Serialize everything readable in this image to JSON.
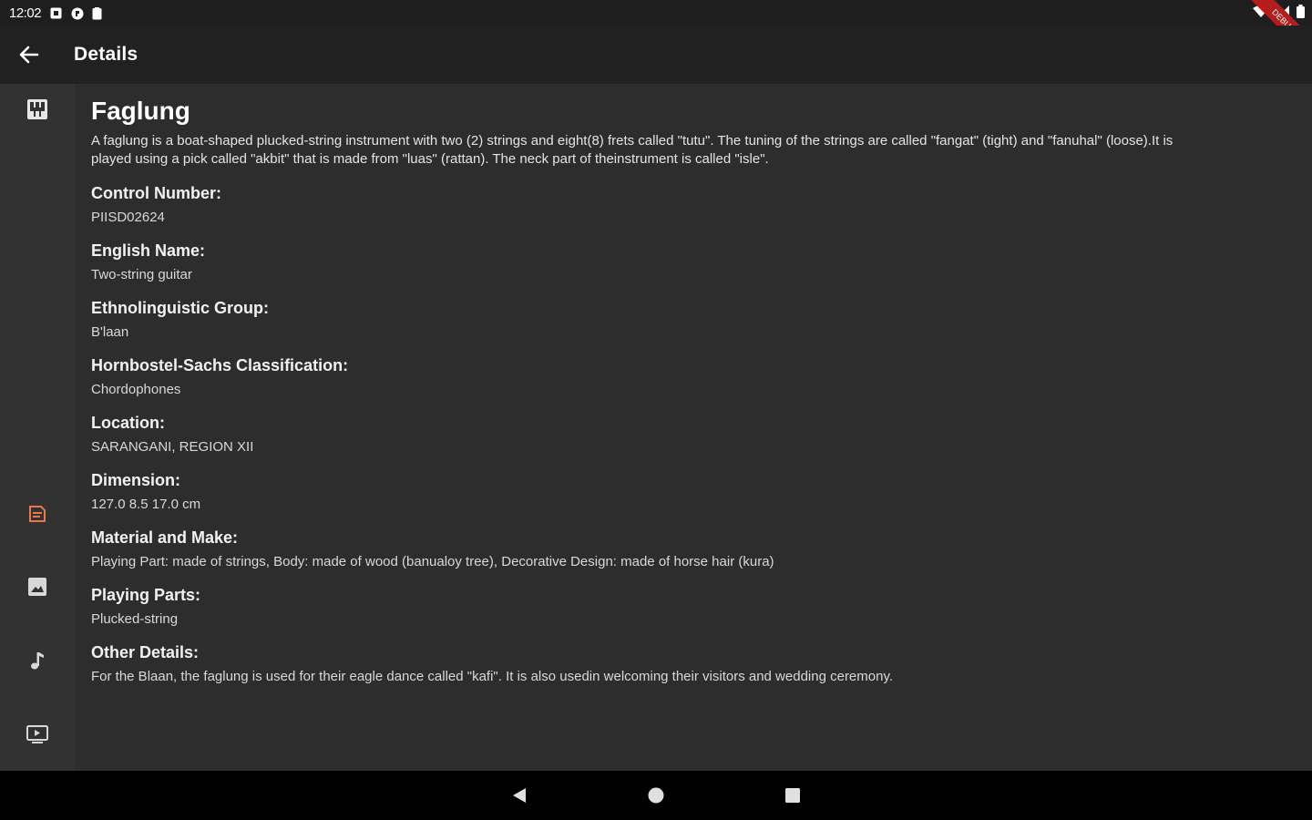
{
  "status_bar": {
    "time": "12:02",
    "icons_left": [
      "notification-icon",
      "system-icon",
      "battery-saver-icon"
    ],
    "icons_right": [
      "wifi-icon",
      "signal-icon",
      "battery-icon"
    ]
  },
  "debug_banner": "DEBUG",
  "app_bar": {
    "title": "Details",
    "back_icon": "arrow-back-icon"
  },
  "rail": {
    "items": [
      {
        "icon": "piano-icon",
        "active": false
      },
      {
        "icon": "article-icon",
        "active": true
      },
      {
        "icon": "image-icon",
        "active": false
      },
      {
        "icon": "music-note-icon",
        "active": false
      },
      {
        "icon": "video-icon",
        "active": false
      }
    ],
    "accent_color": "#e8774a"
  },
  "detail": {
    "title": "Faglung",
    "description": "A faglung is a boat-shaped plucked-string instrument with two (2) strings and eight(8) frets called \"tutu\". The tuning of the strings are called \"fangat\" (tight) and \"fanuhal\" (loose).It is played using a pick called \"akbit\" that is made from \"luas\" (rattan). The neck part of theinstrument is called \"isle\".",
    "fields": [
      {
        "label": "Control Number:",
        "value": "PIISD02624"
      },
      {
        "label": "English Name:",
        "value": "Two-string guitar"
      },
      {
        "label": "Ethnolinguistic Group:",
        "value": "B'laan"
      },
      {
        "label": "Hornbostel-Sachs Classification:",
        "value": "Chordophones"
      },
      {
        "label": "Location:",
        "value": "SARANGANI, REGION XII"
      },
      {
        "label": "Dimension:",
        "value": "127.0  8.5  17.0 cm"
      },
      {
        "label": "Material and Make:",
        "value": "Playing Part: made of strings, Body: made of wood (banualoy tree), Decorative Design: made of horse hair (kura)"
      },
      {
        "label": "Playing Parts:",
        "value": "Plucked-string"
      },
      {
        "label": "Other Details:",
        "value": "For the Blaan, the faglung is used for their eagle dance called \"kafi\". It is also usedin welcoming their visitors and wedding ceremony."
      }
    ]
  },
  "nav_bar": {
    "buttons": [
      "back-triangle-icon",
      "home-circle-icon",
      "recents-square-icon"
    ]
  }
}
